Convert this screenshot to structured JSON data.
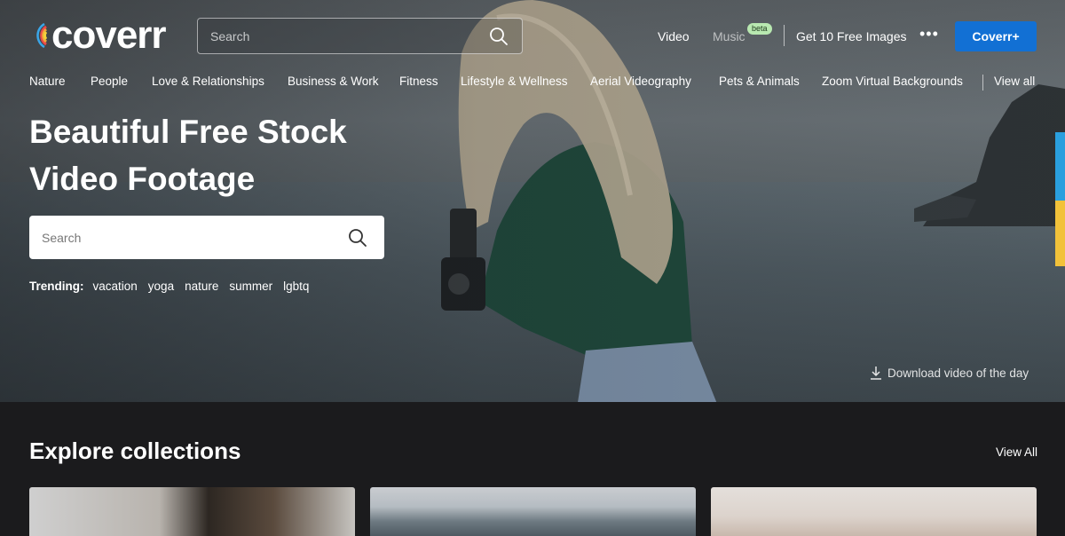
{
  "header": {
    "logo_text": "coverr",
    "search_placeholder": "Search",
    "nav": {
      "video": "Video",
      "music": "Music",
      "music_badge": "beta",
      "free_images": "Get 10 Free Images",
      "more": "•••",
      "coverr_plus": "Coverr+"
    }
  },
  "categories": {
    "items": [
      "Nature",
      "People",
      "Love & Relationships",
      "Business & Work",
      "Fitness",
      "Lifestyle & Wellness",
      "Aerial Videography",
      "Pets & Animals",
      "Zoom Virtual Backgrounds"
    ],
    "view_all": "View all"
  },
  "hero": {
    "title": "Beautiful Free Stock Video Footage",
    "search_placeholder": "Search",
    "trending_label": "Trending:",
    "trending_tags": [
      "vacation",
      "yoga",
      "nature",
      "summer",
      "lgbtq"
    ],
    "download_label": "Download video of the day"
  },
  "collections": {
    "title": "Explore collections",
    "view_all": "View All"
  },
  "colors": {
    "accent_button": "#1270d4",
    "beta_badge": "#b8e8b0",
    "side_tab_blue": "#2a9fde",
    "side_tab_yellow": "#f2c23a",
    "page_background": "#1b1b1d"
  },
  "icons": [
    "logo-rainbow-icon",
    "search-icon",
    "more-dots-icon",
    "download-icon"
  ]
}
